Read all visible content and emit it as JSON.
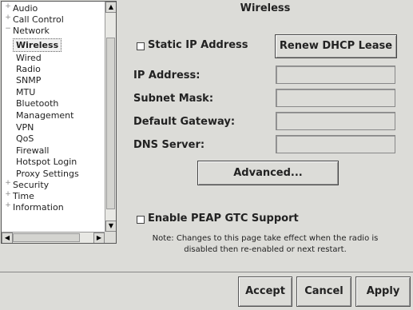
{
  "tree": {
    "items": [
      {
        "label": "Audio",
        "expander": "+"
      },
      {
        "label": "Call Control",
        "expander": "+"
      },
      {
        "label": "Network",
        "expander": "−"
      },
      {
        "label": "Wireless"
      },
      {
        "label": "Wired"
      },
      {
        "label": "Radio"
      },
      {
        "label": "SNMP"
      },
      {
        "label": "MTU"
      },
      {
        "label": "Bluetooth"
      },
      {
        "label": "Management"
      },
      {
        "label": "VPN"
      },
      {
        "label": "QoS"
      },
      {
        "label": "Firewall"
      },
      {
        "label": "Hotspot Login"
      },
      {
        "label": "Proxy Settings"
      },
      {
        "label": "Security",
        "expander": "+"
      },
      {
        "label": "Time",
        "expander": "+"
      },
      {
        "label": "Information",
        "expander": "+"
      }
    ],
    "selected": "Wireless"
  },
  "panel": {
    "title": "Wireless",
    "static_ip_label": "Static IP Address",
    "renew_dhcp_label": "Renew DHCP Lease",
    "ip_address_label": "IP Address:",
    "subnet_mask_label": "Subnet Mask:",
    "default_gateway_label": "Default Gateway:",
    "dns_server_label": "DNS Server:",
    "advanced_label": "Advanced...",
    "peap_label": "Enable PEAP GTC Support",
    "note_line1": "Note: Changes to this page take effect when the radio is",
    "note_line2": "disabled then re-enabled or next restart."
  },
  "footer": {
    "accept_label": "Accept",
    "cancel_label": "Cancel",
    "apply_label": "Apply"
  }
}
